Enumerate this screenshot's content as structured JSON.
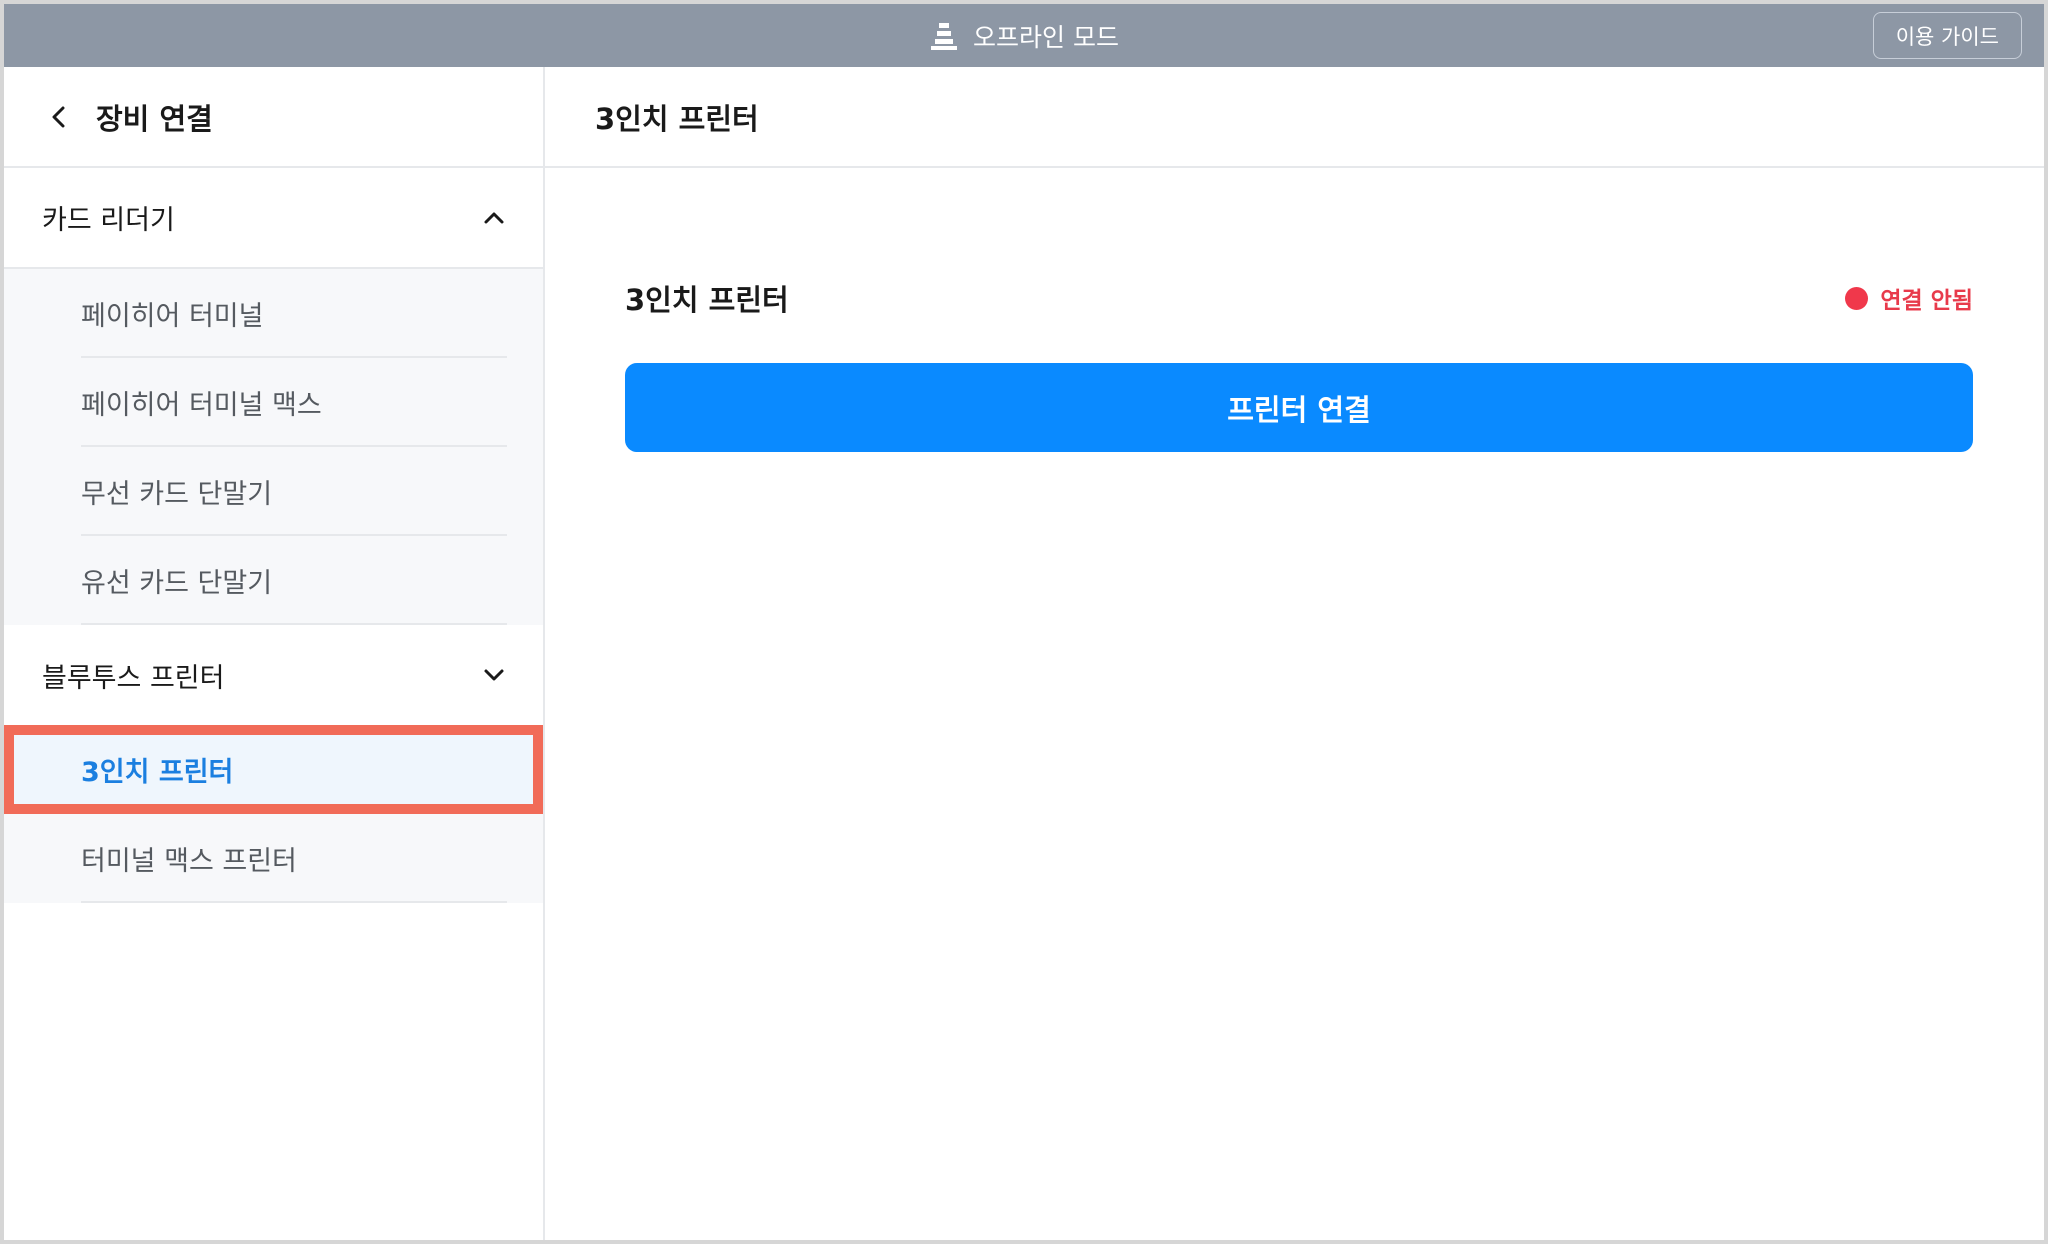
{
  "topbar": {
    "mode_icon": "traffic-cone-icon",
    "mode_label": "오프라인 모드",
    "guide_button": "이용 가이드"
  },
  "sidebar": {
    "back_icon": "chevron-left-icon",
    "title": "장비 연결",
    "groups": [
      {
        "label": "카드 리더기",
        "expanded": true,
        "chevron_icon": "chevron-up-icon",
        "items": [
          {
            "label": "페이히어 터미널"
          },
          {
            "label": "페이히어 터미널 맥스"
          },
          {
            "label": "무선 카드 단말기"
          },
          {
            "label": "유선 카드 단말기"
          }
        ]
      },
      {
        "label": "블루투스 프린터",
        "expanded": true,
        "chevron_icon": "chevron-down-icon",
        "items": [
          {
            "label": "3인치 프린터",
            "selected": true
          },
          {
            "label": "터미널 맥스 프린터"
          }
        ]
      }
    ]
  },
  "main": {
    "title": "3인치 프린터",
    "device_name": "3인치 프린터",
    "status": {
      "label": "연결 안됨",
      "color": "#f0384b"
    },
    "connect_button": "프린터 연결"
  },
  "colors": {
    "topbar": "#8d97a5",
    "accent": "#0a8aff",
    "selected_text": "#1b7fe0",
    "highlight_border": "#f16b58",
    "error": "#e83a4b"
  }
}
